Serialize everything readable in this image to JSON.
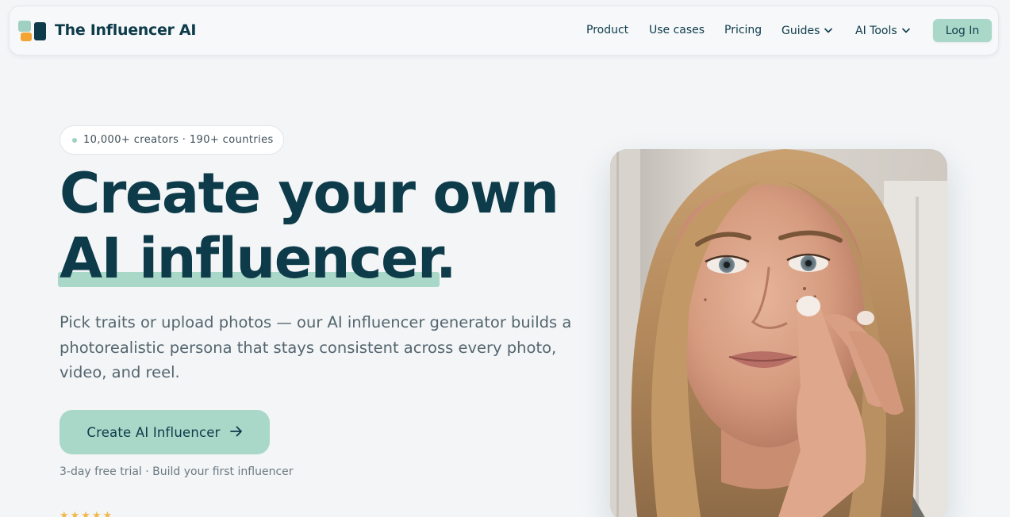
{
  "brand": {
    "name": "The Influencer AI"
  },
  "nav": {
    "product": "Product",
    "use_cases": "Use cases",
    "pricing": "Pricing",
    "guides": "Guides",
    "ai_tools": "AI Tools",
    "login": "Log In"
  },
  "hero": {
    "badge": "10,000+ creators · 190+ countries",
    "title_line1": "Create your own",
    "title_line2": "AI influencer.",
    "subtitle": "Pick traits or upload photos — our AI influencer generator builds a photorealistic persona that stays consistent across every photo, video, and reel.",
    "cta": "Create AI Influencer",
    "trial_note": "3-day free trial · Build your first influencer",
    "rating_stars": "★★★★★"
  },
  "colors": {
    "primary": "#0d3b4a",
    "accent": "#a9d8c8",
    "orange": "#f2a533",
    "background": "#f3f5f7"
  },
  "icons": {
    "logo": "brand-logo-icon",
    "dropdown": "chevron-down-icon",
    "cta_arrow": "arrow-right-icon"
  }
}
